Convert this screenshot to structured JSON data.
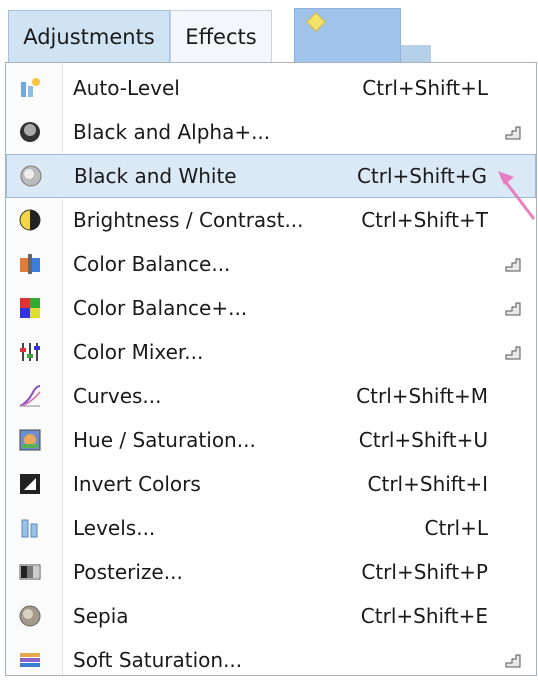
{
  "menubar": {
    "tabs": [
      {
        "label": "Adjustments"
      },
      {
        "label": "Effects"
      }
    ]
  },
  "menu": {
    "items": [
      {
        "label": "Auto-Level",
        "shortcut": "Ctrl+Shift+L",
        "icon": "auto-level-icon",
        "plugin": false
      },
      {
        "label": "Black and Alpha+...",
        "shortcut": "",
        "icon": "black-alpha-icon",
        "plugin": true
      },
      {
        "label": "Black and White",
        "shortcut": "Ctrl+Shift+G",
        "icon": "black-white-icon",
        "plugin": false,
        "highlighted": true
      },
      {
        "label": "Brightness / Contrast...",
        "shortcut": "Ctrl+Shift+T",
        "icon": "brightness-contrast-icon",
        "plugin": false
      },
      {
        "label": "Color Balance...",
        "shortcut": "",
        "icon": "color-balance-icon",
        "plugin": true
      },
      {
        "label": "Color Balance+...",
        "shortcut": "",
        "icon": "color-balance-plus-icon",
        "plugin": true
      },
      {
        "label": "Color Mixer...",
        "shortcut": "",
        "icon": "color-mixer-icon",
        "plugin": true
      },
      {
        "label": "Curves...",
        "shortcut": "Ctrl+Shift+M",
        "icon": "curves-icon",
        "plugin": false
      },
      {
        "label": "Hue / Saturation...",
        "shortcut": "Ctrl+Shift+U",
        "icon": "hue-saturation-icon",
        "plugin": false
      },
      {
        "label": "Invert Colors",
        "shortcut": "Ctrl+Shift+I",
        "icon": "invert-colors-icon",
        "plugin": false
      },
      {
        "label": "Levels...",
        "shortcut": "Ctrl+L",
        "icon": "levels-icon",
        "plugin": false
      },
      {
        "label": "Posterize...",
        "shortcut": "Ctrl+Shift+P",
        "icon": "posterize-icon",
        "plugin": false
      },
      {
        "label": "Sepia",
        "shortcut": "Ctrl+Shift+E",
        "icon": "sepia-icon",
        "plugin": false
      },
      {
        "label": "Soft Saturation...",
        "shortcut": "",
        "icon": "soft-saturation-icon",
        "plugin": true
      }
    ]
  },
  "colors": {
    "highlight_bg": "#dbe9f6",
    "highlight_border": "#9dbbd8",
    "active_tab": "#cfe3f3",
    "arrow": "#e87fc0"
  }
}
